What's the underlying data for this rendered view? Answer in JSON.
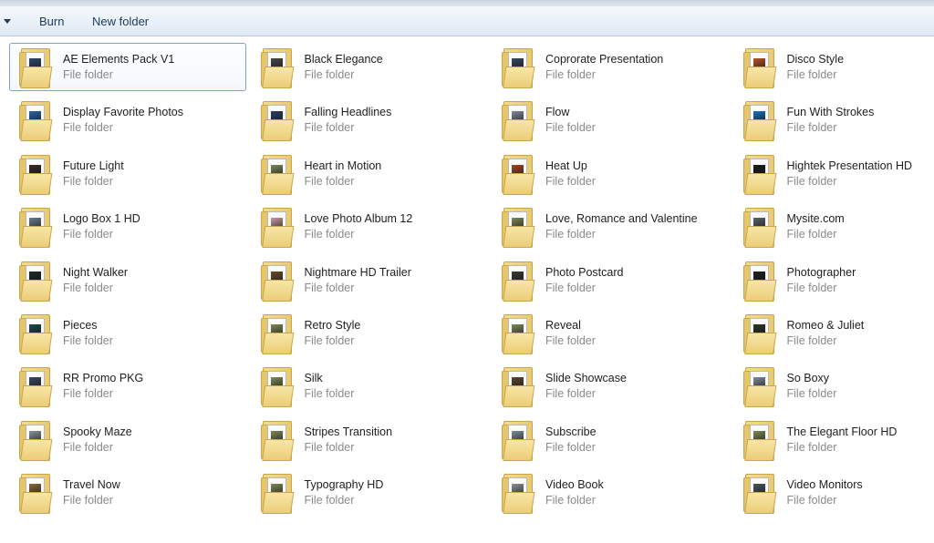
{
  "toolbar": {
    "burn_label": "Burn",
    "new_folder_label": "New folder"
  },
  "folders": [
    {
      "name": "AE Elements Pack V1",
      "type": "File folder",
      "color": "#2f4a6b",
      "selected": true
    },
    {
      "name": "Black Elegance",
      "type": "File folder",
      "color": "#4a4a4a"
    },
    {
      "name": "Coprorate Presentation",
      "type": "File folder",
      "color": "#3a4a5e"
    },
    {
      "name": "Disco Style",
      "type": "File folder",
      "color": "#b8542a"
    },
    {
      "name": "Display Favorite Photos",
      "type": "File folder",
      "color": "#2b66a8"
    },
    {
      "name": "Falling Headlines",
      "type": "File folder",
      "color": "#2c3e66"
    },
    {
      "name": "Flow",
      "type": "File folder",
      "color": "#7f8c99"
    },
    {
      "name": "Fun With Strokes",
      "type": "File folder",
      "color": "#1f6fb5"
    },
    {
      "name": "Future Light",
      "type": "File folder",
      "color": "#3a2a22"
    },
    {
      "name": "Heart in Motion",
      "type": "File folder",
      "color": "#7d8a5a"
    },
    {
      "name": "Heat Up",
      "type": "File folder",
      "color": "#a5471f"
    },
    {
      "name": "Hightek Presentation HD",
      "type": "File folder",
      "color": "#1c1c1c"
    },
    {
      "name": "Logo Box 1 HD",
      "type": "File folder",
      "color": "#6b7d8f"
    },
    {
      "name": "Love Photo Album 12",
      "type": "File folder",
      "color": "#c99aa2"
    },
    {
      "name": "Love, Romance and Valentine",
      "type": "File folder",
      "color": "#7d8a5a"
    },
    {
      "name": "Mysite.com",
      "type": "File folder",
      "color": "#5b6470"
    },
    {
      "name": "Night Walker",
      "type": "File folder",
      "color": "#1c2a2a"
    },
    {
      "name": "Nightmare HD Trailer",
      "type": "File folder",
      "color": "#6b4a2a"
    },
    {
      "name": "Photo Postcard",
      "type": "File folder",
      "color": "#3a3a3a"
    },
    {
      "name": "Photographer",
      "type": "File folder",
      "color": "#222222"
    },
    {
      "name": "Pieces",
      "type": "File folder",
      "color": "#1e4a4f"
    },
    {
      "name": "Retro Style",
      "type": "File folder",
      "color": "#7d8a5a"
    },
    {
      "name": "Reveal",
      "type": "File folder",
      "color": "#7d8a5a"
    },
    {
      "name": "Romeo & Juliet",
      "type": "File folder",
      "color": "#2a3a2a"
    },
    {
      "name": "RR Promo PKG",
      "type": "File folder",
      "color": "#3a4a5e"
    },
    {
      "name": "Silk",
      "type": "File folder",
      "color": "#7d8a5a"
    },
    {
      "name": "Slide Showcase",
      "type": "File folder",
      "color": "#5a4a2a"
    },
    {
      "name": "So Boxy",
      "type": "File folder",
      "color": "#7f8c99"
    },
    {
      "name": "Spooky Maze",
      "type": "File folder",
      "color": "#8a939b"
    },
    {
      "name": "Stripes Transition",
      "type": "File folder",
      "color": "#7d8a5a"
    },
    {
      "name": "Subscribe",
      "type": "File folder",
      "color": "#7f8c99"
    },
    {
      "name": "The Elegant Floor HD",
      "type": "File folder",
      "color": "#7d8a5a"
    },
    {
      "name": "Travel Now",
      "type": "File folder",
      "color": "#8a6a3a"
    },
    {
      "name": "Typography HD",
      "type": "File folder",
      "color": "#7d8a5a"
    },
    {
      "name": "Video Book",
      "type": "File folder",
      "color": "#8a939b"
    },
    {
      "name": "Video Monitors",
      "type": "File folder",
      "color": "#4a5562"
    }
  ]
}
